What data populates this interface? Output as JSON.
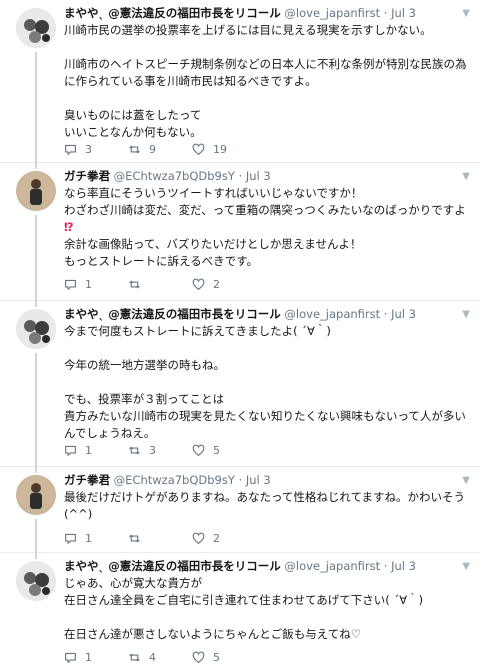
{
  "tweets": [
    {
      "name": "まややˎ @憲法違反の福田市長をリコール",
      "handle": "@love_japanfirst",
      "dot": "·",
      "time": "Jul 3",
      "lines": [
        "川崎市民の選挙の投票率を上げるには目に見える現実を示すしかない。",
        "",
        "川崎市のヘイトスピーチ規制条例などの日本人に不利な条例が特別な民族の為",
        "に作られている事を川崎市民は知るべきですよ。",
        "",
        "臭いものには蓋をしたって",
        "いいことなんか何もない。"
      ],
      "reply_count": "3",
      "retweet_count": "9",
      "like_count": "19"
    },
    {
      "name": "ガチ拳君",
      "handle": "@EChtwza7bQDb9sY",
      "dot": "·",
      "time": "Jul 3",
      "lines": [
        "なら率直にそういうツイートすればいいじゃないですか！",
        "わざわざ川崎は変だ、変だ、って重箱の隅突っつくみたいなのばっかりですよ",
        "⁉",
        "余計な画像貼って、バズりたいだけとしか思えませんよ！",
        "もっとストレートに訴えるべきです。"
      ],
      "reply_count": "1",
      "retweet_count": "",
      "like_count": "2"
    },
    {
      "name": "まややˎ @憲法違反の福田市長をリコール",
      "handle": "@love_japanfirst",
      "dot": "·",
      "time": "Jul 3",
      "lines": [
        "今まで何度もストレートに訴えてきましたよ( ´∀｀)",
        "",
        "今年の統一地方選挙の時もね。",
        "",
        "でも、投票率が３割ってことは",
        "貴方みたいな川崎市の現実を見たくない知りたくない興味もないって人が多い",
        "んでしょうねえ。"
      ],
      "reply_count": "1",
      "retweet_count": "3",
      "like_count": "5"
    },
    {
      "name": "ガチ拳君",
      "handle": "@EChtwza7bQDb9sY",
      "dot": "·",
      "time": "Jul 3",
      "lines": [
        "最後だけだけトゲがありますね。あなたって性格ねじれてますね。かわいそう",
        "(^^)"
      ],
      "reply_count": "1",
      "retweet_count": "",
      "like_count": "2"
    },
    {
      "name": "まややˎ @憲法違反の福田市長をリコール",
      "handle": "@love_japanfirst",
      "dot": "·",
      "time": "Jul 3",
      "lines": [
        "じゃあ、心が寛大な貴方が",
        "在日さん達全員をご自宅に引き連れて住まわせてあげて下さい( ´∀｀)",
        "",
        "在日さん達が悪さしないようにちゃんとご飯も与えてね♡"
      ],
      "reply_count": "1",
      "retweet_count": "4",
      "like_count": "5"
    }
  ],
  "icons": {
    "reply": "reply-icon",
    "retweet": "retweet-icon",
    "like": "heart-icon",
    "caret": "chevron-down-icon"
  },
  "colors": {
    "text": "#14171a",
    "meta": "#657786",
    "divider": "#e6ecf0"
  }
}
